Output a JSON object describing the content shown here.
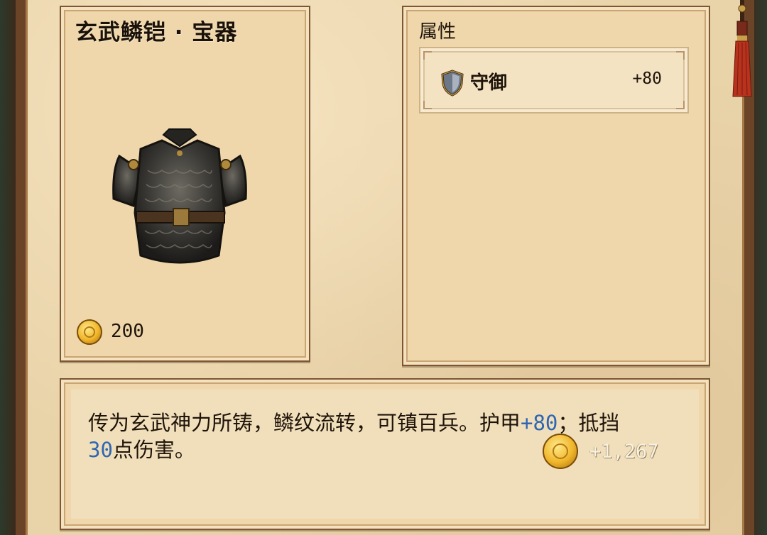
{
  "item": {
    "title": "玄武鳞铠 · 宝器",
    "icon": "armor-icon",
    "price": "200",
    "price_icon": "gold-coin-icon"
  },
  "attributes": {
    "title": "属性",
    "rows": [
      {
        "name": "守御",
        "value": "+80",
        "icon": "shield-icon"
      }
    ]
  },
  "description": {
    "text_part1": "传为玄武神力所铸，鳞纹流转，可镇百兵。护甲",
    "armor_value": "+80",
    "text_part2": "；抵挡",
    "block_value": "30",
    "text_part3": "点伤害。",
    "reward_value": "+1,267",
    "reward_icon": "gold-coin-icon"
  },
  "colors": {
    "parchment": "#efd7ab",
    "frame": "#6b4427",
    "highlight_blue": "#2f66b3",
    "gold": "#f0b62a"
  }
}
